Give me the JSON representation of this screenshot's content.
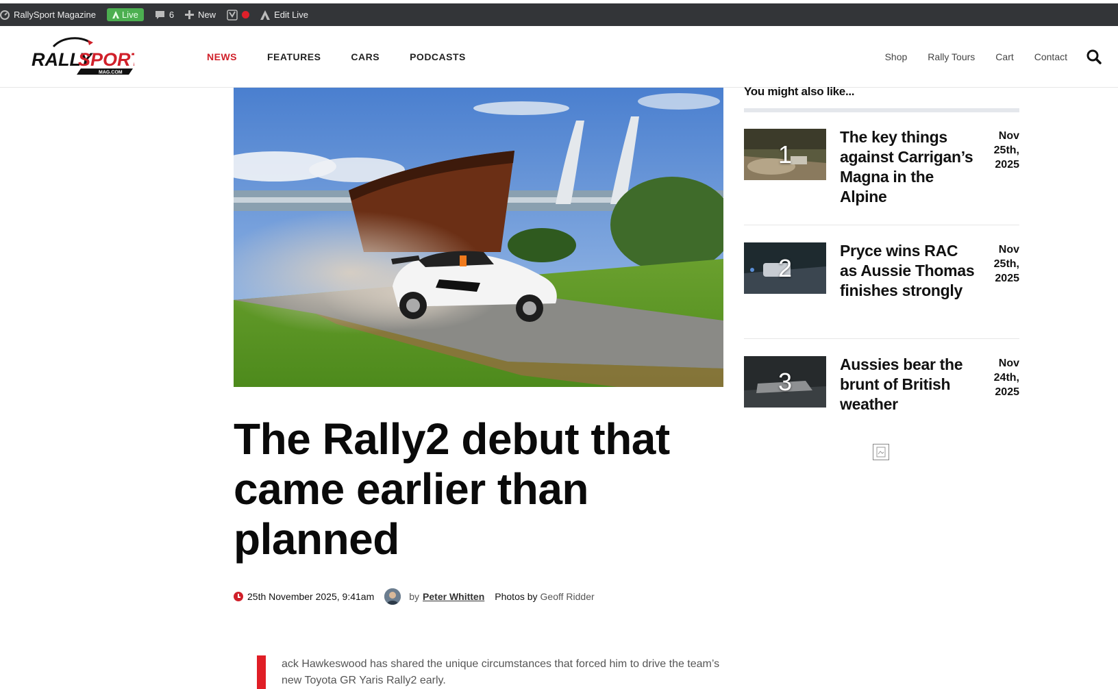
{
  "admin_bar": {
    "site_name": "RallySport Magazine",
    "live_label": "Live",
    "comments_count": "6",
    "new_label": "New",
    "edit_live_label": "Edit Live"
  },
  "header": {
    "logo_text_rally": "RALLY",
    "logo_text_sport": "SPORT",
    "logo_subtext": "MAG.COM",
    "main_nav": [
      "NEWS",
      "FEATURES",
      "CARS",
      "PODCASTS"
    ],
    "active_nav": "NEWS",
    "util_nav": [
      "Shop",
      "Rally Tours",
      "Cart",
      "Contact"
    ]
  },
  "article": {
    "title": "The Rally2 debut that came earlier than planned",
    "date": "25th November 2025, 9:41am",
    "by": "by",
    "author": "Peter Whitten",
    "photos_label": "Photos by",
    "photographer": "Geoff Ridder",
    "intro": "ack Hawkeswood has shared the unique circumstances that forced him to drive the team’s new Toyota GR Yaris Rally2 early."
  },
  "sidebar": {
    "heading": "You might also like...",
    "items": [
      {
        "num": "1",
        "title": "The key things against Carrigan’s Magna in the Alpine",
        "date": "Nov 25th, 2025"
      },
      {
        "num": "2",
        "title": "Pryce wins RAC as Aussie Thomas finishes strongly",
        "date": "Nov 25th, 2025"
      },
      {
        "num": "3",
        "title": "Aussies bear the brunt of British weather",
        "date": "Nov 24th, 2025"
      }
    ]
  },
  "colors": {
    "accent_red": "#d0202a",
    "admin_bar_bg": "#333538",
    "live_green": "#4caf50"
  }
}
